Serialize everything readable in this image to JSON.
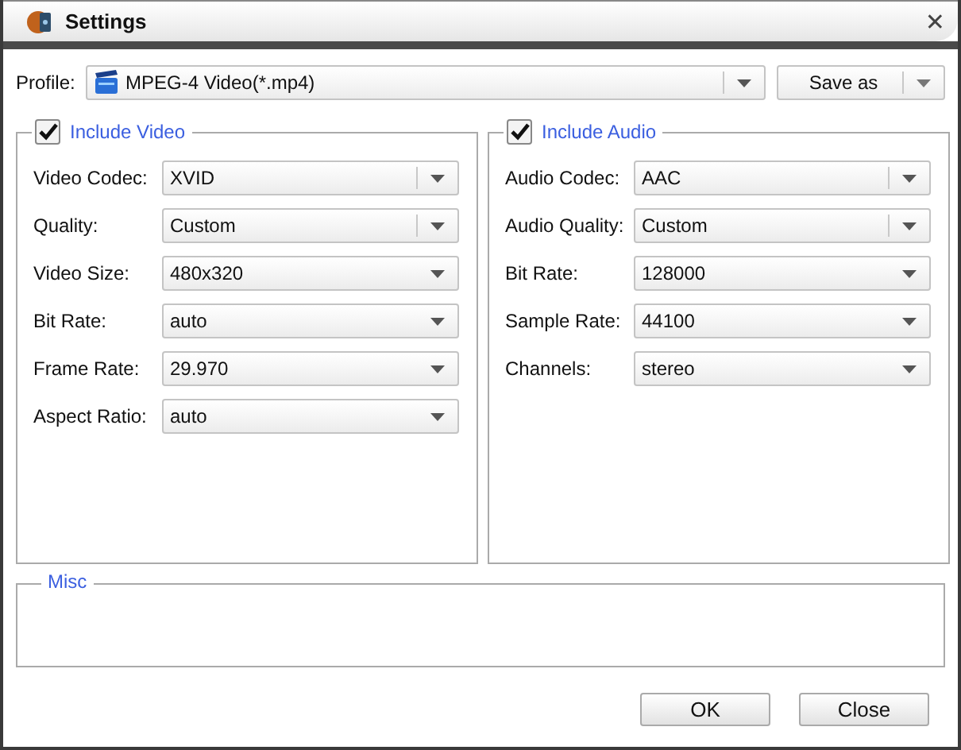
{
  "window": {
    "title": "Settings",
    "close": "✕"
  },
  "profile": {
    "label": "Profile:",
    "value": "MPEG-4 Video(*.mp4)",
    "save_button": "Save as"
  },
  "groups": [
    {
      "title": "Include Video",
      "checked": true,
      "fields": [
        {
          "label": "Video Codec:",
          "value": "XVID",
          "divider": true
        },
        {
          "label": "Quality:",
          "value": "Custom",
          "divider": true
        },
        {
          "label": "Video Size:",
          "value": "480x320",
          "divider": false
        },
        {
          "label": "Bit Rate:",
          "value": "auto",
          "divider": false
        },
        {
          "label": "Frame Rate:",
          "value": "29.970",
          "divider": false
        },
        {
          "label": "Aspect Ratio:",
          "value": "auto",
          "divider": false
        }
      ]
    },
    {
      "title": "Include Audio",
      "checked": true,
      "fields": [
        {
          "label": "Audio Codec:",
          "value": "AAC",
          "divider": true
        },
        {
          "label": "Audio Quality:",
          "value": "Custom",
          "divider": true
        },
        {
          "label": "Bit Rate:",
          "value": "128000",
          "divider": false
        },
        {
          "label": "Sample Rate:",
          "value": "44100",
          "divider": false
        },
        {
          "label": "Channels:",
          "value": "stereo",
          "divider": false
        }
      ]
    }
  ],
  "misc": {
    "title": "Misc"
  },
  "buttons": [
    "OK",
    "Close"
  ]
}
